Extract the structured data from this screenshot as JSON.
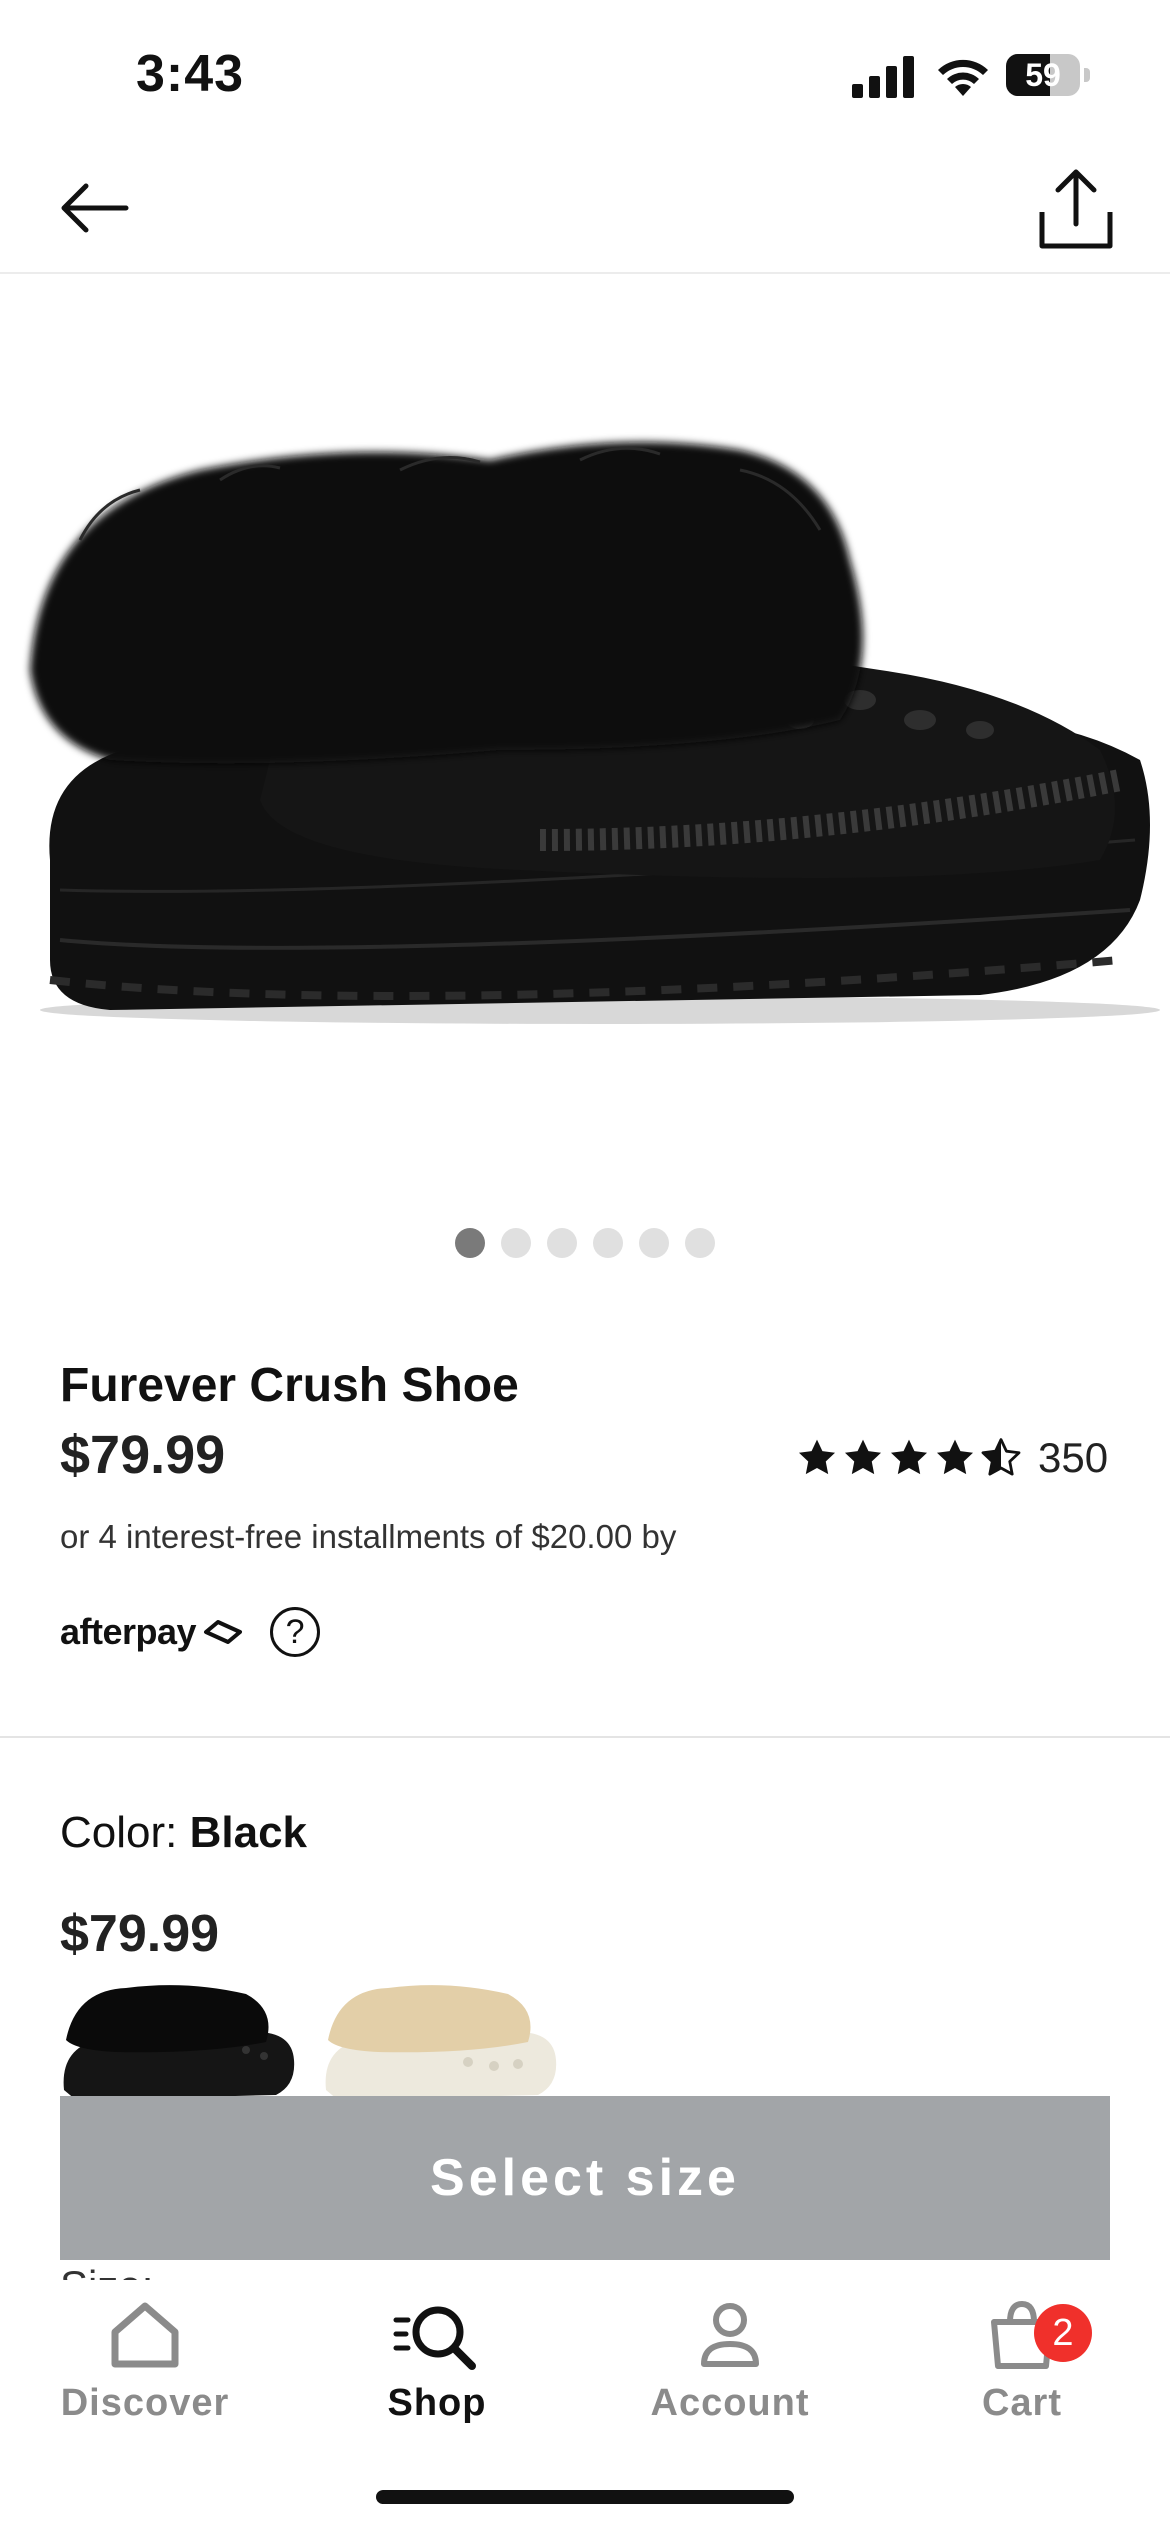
{
  "status_bar": {
    "time": "3:43",
    "battery": "59",
    "battery_level": 0.59
  },
  "product": {
    "name": "Furever Crush Shoe",
    "price": "$79.99",
    "rating": 4.5,
    "rating_count": "350",
    "installments_text": "or 4 interest-free installments of $20.00 by",
    "afterpay_label": "afterpay",
    "help_label": "?"
  },
  "gallery": {
    "image_count": 6,
    "active_index": 0
  },
  "color": {
    "label": "Color:",
    "value": "Black",
    "price": "$79.99",
    "swatches": [
      "Black",
      "Cream"
    ]
  },
  "size": {
    "label": "Size:"
  },
  "cta": {
    "select_size": "Select size"
  },
  "tabbar": {
    "tabs": [
      {
        "label": "Discover",
        "icon": "home-icon"
      },
      {
        "label": "Shop",
        "icon": "search-icon",
        "active": true
      },
      {
        "label": "Account",
        "icon": "person-icon"
      },
      {
        "label": "Cart",
        "icon": "bag-icon",
        "badge": "2"
      }
    ]
  },
  "colors": {
    "cta_bg": "#a2a5a8",
    "badge_red": "#f0302b",
    "inactive_tab": "#8b8b8b"
  }
}
